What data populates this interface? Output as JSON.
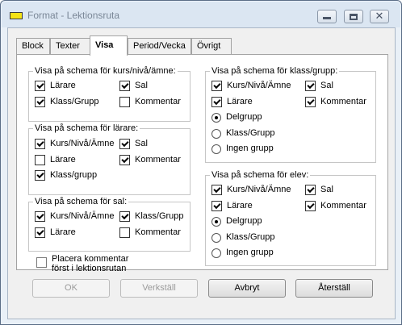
{
  "window": {
    "title": "Format - Lektionsruta"
  },
  "tabs": [
    {
      "label": "Block",
      "active": false
    },
    {
      "label": "Texter",
      "active": false
    },
    {
      "label": "Visa",
      "active": true
    },
    {
      "label": "Period/Vecka",
      "active": false
    },
    {
      "label": "Övrigt",
      "active": false
    }
  ],
  "groups": {
    "kurs": {
      "title": "Visa på schema för kurs/nivå/ämne:",
      "options": [
        {
          "label": "Lärare",
          "checked": true
        },
        {
          "label": "Sal",
          "checked": true
        },
        {
          "label": "Klass/Grupp",
          "checked": true
        },
        {
          "label": "Kommentar",
          "checked": false
        }
      ]
    },
    "larare": {
      "title": "Visa på schema för lärare:",
      "options": [
        {
          "label": "Kurs/Nivå/Ämne",
          "checked": true
        },
        {
          "label": "Sal",
          "checked": true
        },
        {
          "label": "Lärare",
          "checked": false
        },
        {
          "label": "Kommentar",
          "checked": true
        },
        {
          "label": "Klass/grupp",
          "checked": true
        }
      ]
    },
    "sal": {
      "title": "Visa på schema för sal:",
      "options": [
        {
          "label": "Kurs/Nivå/Ämne",
          "checked": true
        },
        {
          "label": "Klass/Grupp",
          "checked": true
        },
        {
          "label": "Lärare",
          "checked": true
        },
        {
          "label": "Kommentar",
          "checked": false
        }
      ]
    },
    "placera": {
      "label_line1": "Placera kommentar",
      "label_line2": "först i lektionsrutan",
      "checked": false
    },
    "klass": {
      "title": "Visa på schema för klass/grupp:",
      "options": [
        {
          "label": "Kurs/Nivå/Ämne",
          "checked": true
        },
        {
          "label": "Sal",
          "checked": true
        },
        {
          "label": "Lärare",
          "checked": true
        },
        {
          "label": "Kommentar",
          "checked": true
        }
      ],
      "radios": [
        {
          "label": "Delgrupp",
          "checked": true
        },
        {
          "label": "Klass/Grupp",
          "checked": false
        },
        {
          "label": "Ingen grupp",
          "checked": false
        }
      ]
    },
    "elev": {
      "title": "Visa på schema för elev:",
      "options": [
        {
          "label": "Kurs/Nivå/Ämne",
          "checked": true
        },
        {
          "label": "Sal",
          "checked": true
        },
        {
          "label": "Lärare",
          "checked": true
        },
        {
          "label": "Kommentar",
          "checked": true
        }
      ],
      "radios": [
        {
          "label": "Delgrupp",
          "checked": true
        },
        {
          "label": "Klass/Grupp",
          "checked": false
        },
        {
          "label": "Ingen grupp",
          "checked": false
        }
      ]
    }
  },
  "buttons": {
    "ok": {
      "label": "OK",
      "enabled": false
    },
    "apply": {
      "label": "Verkställ",
      "enabled": false
    },
    "cancel": {
      "label": "Avbryt",
      "enabled": true
    },
    "reset": {
      "label": "Återställ",
      "enabled": true
    }
  },
  "colors": {
    "app_icon": "#f5e316",
    "title_text": "#7a8797",
    "disabled_text": "#9a9a9a"
  }
}
